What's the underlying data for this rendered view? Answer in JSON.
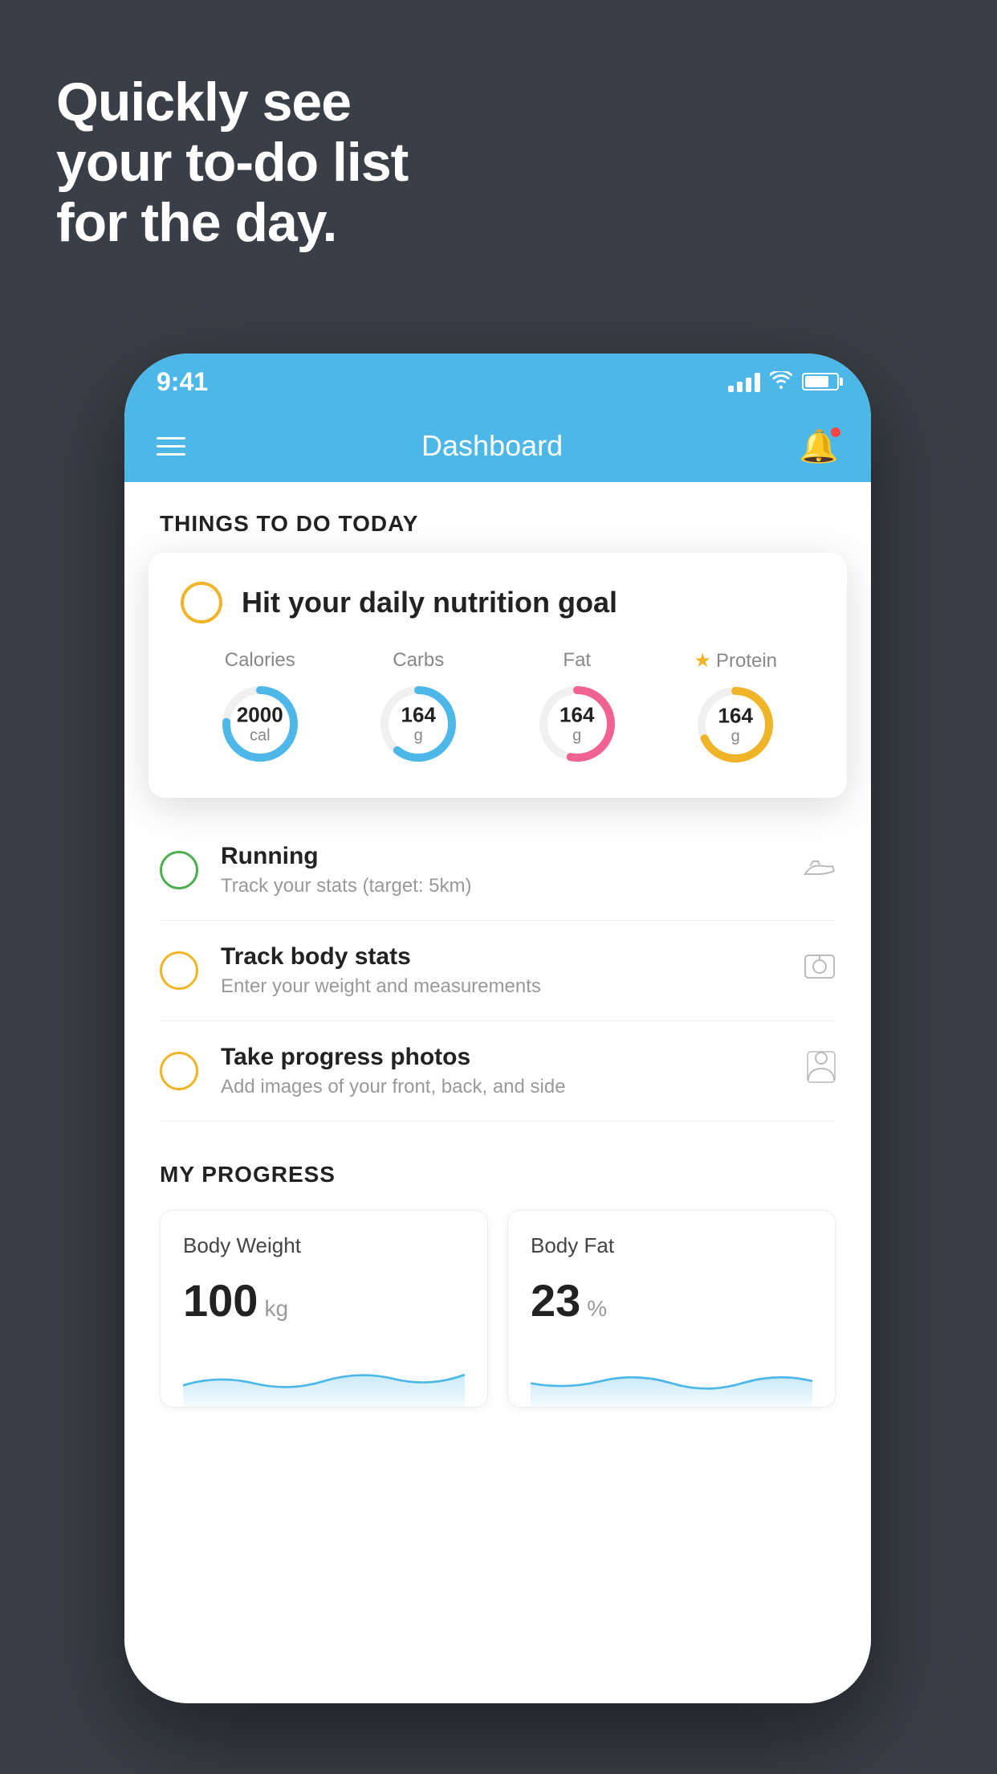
{
  "hero": {
    "line1": "Quickly see",
    "line2": "your to-do list",
    "line3": "for the day."
  },
  "statusBar": {
    "time": "9:41"
  },
  "navbar": {
    "title": "Dashboard"
  },
  "thingsToDo": {
    "sectionTitle": "THINGS TO DO TODAY",
    "floatingCard": {
      "title": "Hit your daily nutrition goal",
      "stats": [
        {
          "label": "Calories",
          "value": "2000",
          "unit": "cal",
          "color": "blue",
          "starred": false
        },
        {
          "label": "Carbs",
          "value": "164",
          "unit": "g",
          "color": "blue",
          "starred": false
        },
        {
          "label": "Fat",
          "value": "164",
          "unit": "g",
          "color": "pink",
          "starred": false
        },
        {
          "label": "Protein",
          "value": "164",
          "unit": "g",
          "color": "yellow",
          "starred": true
        }
      ]
    },
    "items": [
      {
        "title": "Running",
        "subtitle": "Track your stats (target: 5km)",
        "circleColor": "green",
        "icon": "shoe"
      },
      {
        "title": "Track body stats",
        "subtitle": "Enter your weight and measurements",
        "circleColor": "yellow",
        "icon": "scale"
      },
      {
        "title": "Take progress photos",
        "subtitle": "Add images of your front, back, and side",
        "circleColor": "yellow",
        "icon": "person"
      }
    ]
  },
  "myProgress": {
    "sectionTitle": "MY PROGRESS",
    "cards": [
      {
        "title": "Body Weight",
        "value": "100",
        "unit": "kg"
      },
      {
        "title": "Body Fat",
        "value": "23",
        "unit": "%"
      }
    ]
  }
}
